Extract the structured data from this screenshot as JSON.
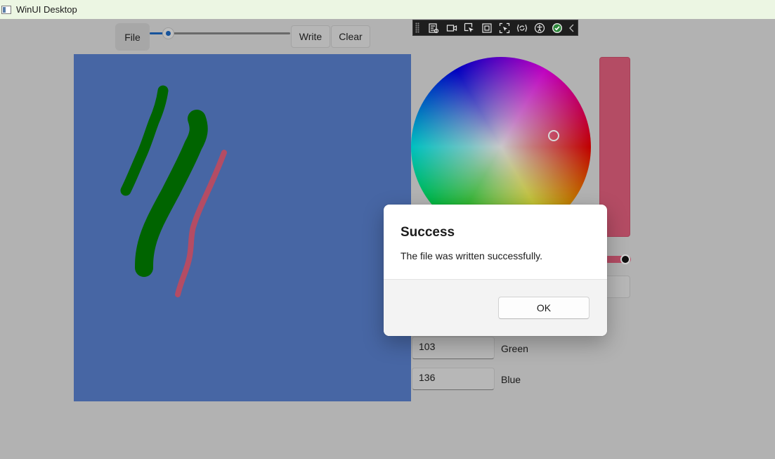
{
  "window": {
    "title": "WinUI Desktop"
  },
  "toolbar": {
    "file_label": "File",
    "write_label": "Write",
    "clear_label": "Clear",
    "stroke_slider_fraction": 0.13
  },
  "debug_toolbar": {
    "tools": [
      "live-visual-tree-icon",
      "record-icon",
      "select-element-icon",
      "display-layout-adorners-icon",
      "track-focus-icon",
      "hot-reload-icon",
      "accessibility-checker-icon",
      "binding-failures-ok-icon",
      "collapse-chevron-icon"
    ]
  },
  "canvas": {
    "background": "#4766a4",
    "strokes": [
      {
        "color": "#006400"
      },
      {
        "color": "#006400"
      },
      {
        "color": "#b44c64"
      }
    ]
  },
  "color_picker": {
    "preview_color": "#b44c64",
    "green_value": "103",
    "green_label": "Green",
    "blue_value": "136",
    "blue_label": "Blue"
  },
  "dialog": {
    "title": "Success",
    "message": "The file was written successfully.",
    "ok_label": "OK"
  }
}
